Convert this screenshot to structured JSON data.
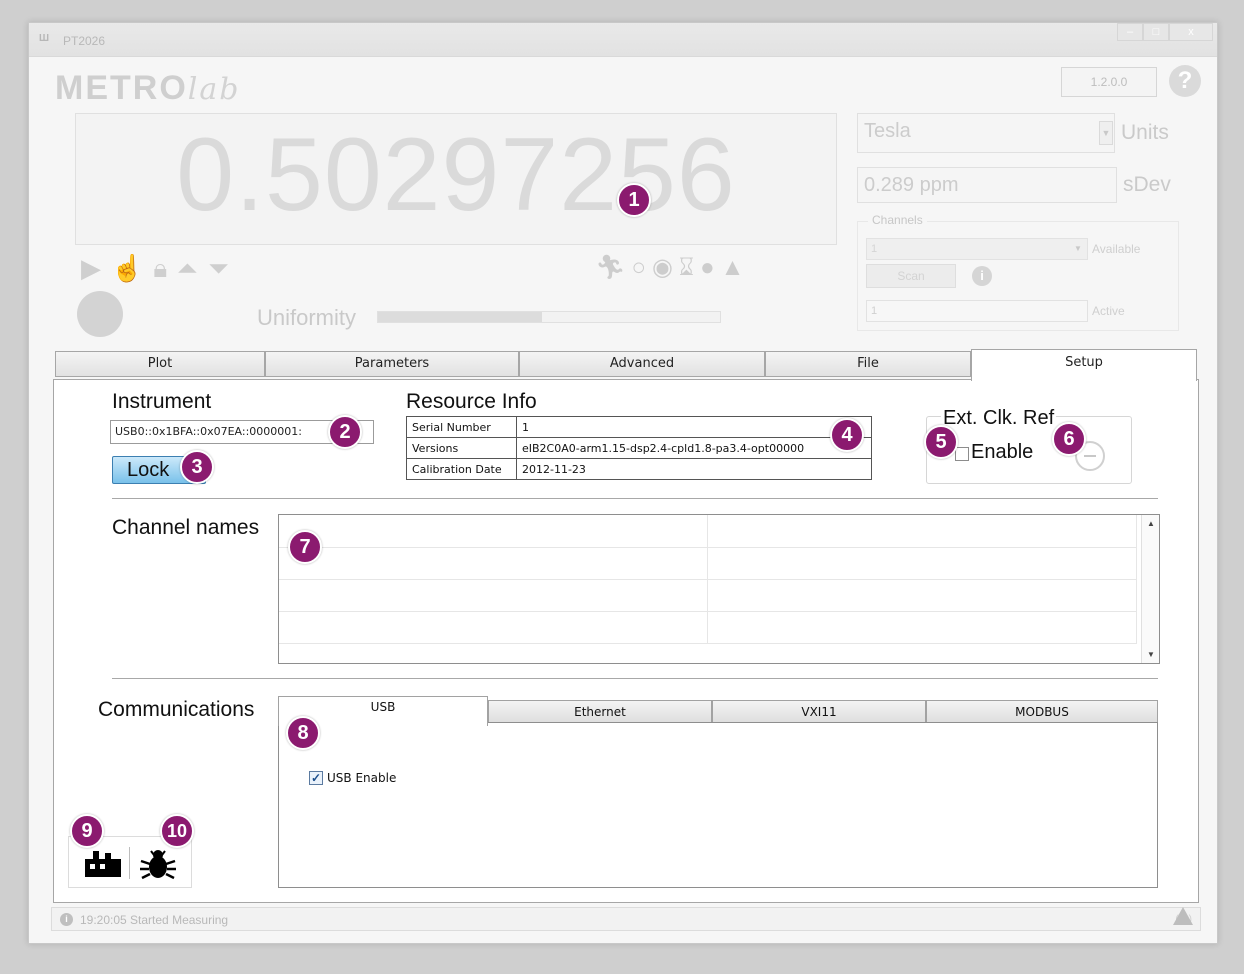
{
  "window": {
    "title": "PT2026",
    "min_symbol": "–",
    "max_symbol": "□",
    "close_symbol": "x"
  },
  "header": {
    "logo_text": "METRO",
    "logo_italic": "lab",
    "version": "1.2.0.0",
    "help_symbol": "?"
  },
  "display": {
    "reading": "0.50297256",
    "uniformity_label": "Uniformity",
    "uniformity_level": 0.48
  },
  "right_panel": {
    "units_value": "Tesla",
    "units_label": "Units",
    "sdev_value": "0.289 ppm",
    "sdev_label": "sDev",
    "channels_legend": "Channels",
    "channel_select": "1",
    "available_label": "Available",
    "scan_label": "Scan",
    "active_value": "1",
    "active_label": "Active"
  },
  "tabs": [
    "Plot",
    "Parameters",
    "Advanced",
    "File",
    "Setup"
  ],
  "setup": {
    "instrument_label": "Instrument",
    "instrument_value": "USB0::0x1BFA::0x07EA::0000001:",
    "lock_label": "Lock",
    "resource_label": "Resource Info",
    "resource_rows": [
      {
        "key": "Serial Number",
        "value": "1"
      },
      {
        "key": "Versions",
        "value": "eIB2C0A0-arm1.15-dsp2.4-cpld1.8-pa3.4-opt00000"
      },
      {
        "key": "Calibration Date",
        "value": "2012-11-23"
      }
    ],
    "ext_clk_title": "Ext. Clk. Ref",
    "ext_enable_label": "Enable",
    "channel_names_label": "Channel names",
    "communications_label": "Communications",
    "comm_tabs": [
      "USB",
      "Ethernet",
      "VXI11",
      "MODBUS"
    ],
    "usb_enable_label": "USB Enable"
  },
  "status": {
    "message": "19:20:05 Started Measuring",
    "connection": "(---)"
  },
  "badges": [
    "1",
    "2",
    "3",
    "4",
    "5",
    "6",
    "7",
    "8",
    "9",
    "10"
  ]
}
